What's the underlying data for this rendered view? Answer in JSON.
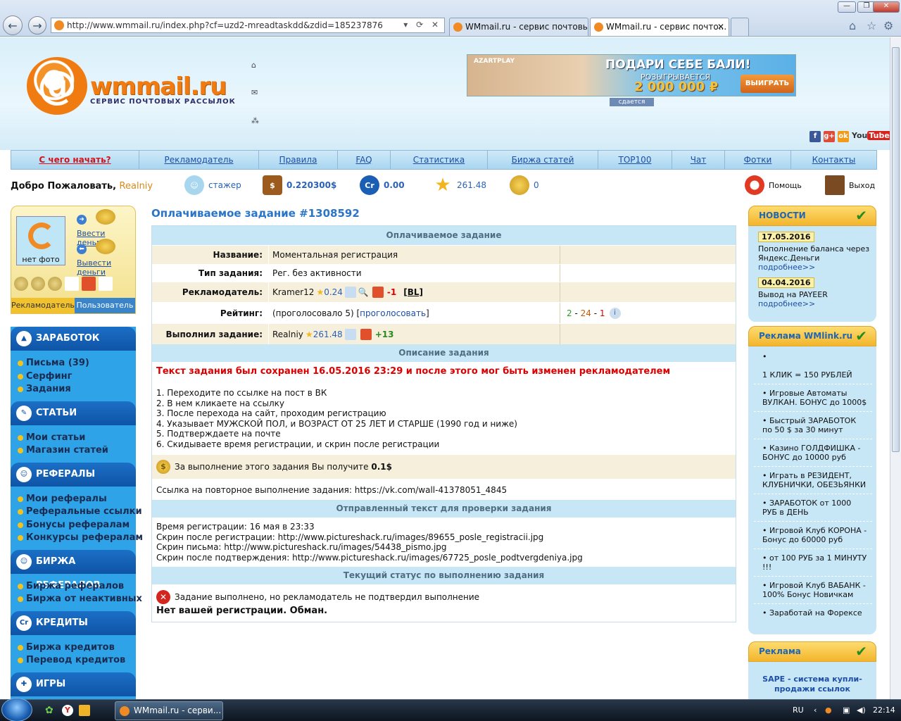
{
  "browser": {
    "url": "http://www.wmmail.ru/index.php?cf=uzd2-mreadtaskdd&zdid=185237876",
    "tabs": [
      "WMmail.ru - сервис почтовы...",
      "WMmail.ru - сервис почто..."
    ]
  },
  "header": {
    "logo_name": "wmmail.ru",
    "logo_sub": "СЕРВИС ПОЧТОВЫХ РАССЫЛОК",
    "banner": {
      "brand": "AZARTPLAY",
      "headline": "ПОДАРИ СЕБЕ БАЛИ!",
      "line2": "РОЗЫГРЫВАЕТСЯ",
      "amount": "2 000 000 ₽",
      "button": "ВЫИГРАТЬ"
    },
    "banner_tag": "сдается",
    "social": [
      "f",
      "g+",
      "ok",
      "YouTube"
    ]
  },
  "menu": [
    "С чего начать?",
    "Рекламодатель",
    "Правила",
    "FAQ",
    "Статистика",
    "Биржа статей",
    "TOP100",
    "Чат",
    "Фотки",
    "Контакты"
  ],
  "welcome": {
    "label": "Добро Пожаловать,",
    "user": "Realniy",
    "rank": "стажер",
    "balance": "0.220300$",
    "credits": "0.00",
    "rating": "261.48",
    "coins": "0",
    "help": "Помощь",
    "exit": "Выход"
  },
  "profile": {
    "photo_caption": "нет фото",
    "deposit": "Ввести деньги",
    "withdraw": "Вывести деньги",
    "tab_advertiser": "Рекламодатель",
    "tab_user": "Пользователь"
  },
  "leftnav": [
    {
      "title": "ЗАРАБОТОК",
      "items": [
        "Письма (39)",
        "Серфинг",
        "Задания"
      ]
    },
    {
      "title": "СТАТЬИ",
      "items": [
        "Мои статьи",
        "Магазин статей"
      ]
    },
    {
      "title": "РЕФЕРАЛЫ",
      "items": [
        "Мои рефералы",
        "Реферальные ссылки",
        "Бонусы рефералам",
        "Конкурсы рефералам"
      ]
    },
    {
      "title": "БИРЖА РЕФЕРАЛОВ",
      "items": [
        "Биржа рефералов",
        "Биржа от неактивных"
      ]
    },
    {
      "title": "КРЕДИТЫ",
      "items": [
        "Биржа кредитов",
        "Перевод кредитов"
      ]
    },
    {
      "title": "ИГРЫ",
      "items": []
    }
  ],
  "task": {
    "page_title": "Оплачиваемое задание #1308592",
    "section_title": "Оплачиваемое задание",
    "name_label": "Название:",
    "name_value": "Моментальная регистрация",
    "type_label": "Тип задания:",
    "type_value": "Рег. без активности",
    "adv_label": "Рекламодатель:",
    "adv_name": "Kramer12",
    "adv_rating": "0.24",
    "adv_score": "-1",
    "adv_bl": "[BL]",
    "rating_label": "Рейтинг:",
    "rating_votes": "(проголосовало 5) [",
    "rating_vote_link": "проголосовать",
    "rating_close": "]",
    "rating_scores": [
      "2",
      "24",
      "1"
    ],
    "done_label": "Выполнил задание:",
    "done_user": "Realniy",
    "done_rating": "261.48",
    "done_score": "+13",
    "desc_title": "Описание задания",
    "saved_notice": "Текст задания был сохранен 16.05.2016 23:29 и после этого мог быть изменен рекламодателем",
    "steps": [
      "1. Переходите по ссылке на пост в ВК",
      "2. В нем кликаете на ссылку",
      "3. После перехода на сайт, проходим регистрацию",
      "4. Указывает МУЖСКОЙ ПОЛ, и ВОЗРАСТ ОТ 25 ЛЕТ И СТАРШЕ (1990 год и ниже)",
      "5. Подтверждаете на почте",
      "6. Скидываете время регистрации, и скрин после регистрации"
    ],
    "reward_text": "За выполнение этого задания Вы получите",
    "reward_value": "0.1$",
    "repeat_label": "Ссылка на повторное выполнение задания:",
    "repeat_link": "https://vk.com/wall-41378051_4845",
    "sent_title": "Отправленный текст для проверки задания",
    "sent_lines": [
      "Время регистрации: 16 мая в 23:33",
      "Скрин после регистрации: http://www.pictureshack.ru/images/89655_posle_registracii.jpg",
      "Скрин письма: http://www.pictureshack.ru/images/54438_pismo.jpg",
      "Скрин после подтверждения: http://www.pictureshack.ru/images/67725_posle_podtvergdeniya.jpg"
    ],
    "status_title": "Текущий статус по выполнению задания",
    "status_text": "Задание выполнено, но рекламодатель не подтвердил выполнение",
    "status_note": "Нет вашей регистрации. Обман."
  },
  "news": {
    "title": "НОВОСТИ",
    "items": [
      {
        "date": "17.05.2016",
        "text": "Пополнение баланса через Яндекс.Деньги",
        "more": "подробнее>>"
      },
      {
        "date": "04.04.2016",
        "text": "Вывод на PAYEER",
        "more": "подробнее>>"
      }
    ]
  },
  "wmlink": {
    "title": "Реклама WMlink.ru",
    "ads": [
      "1 КЛИК = 150 РУБЛЕЙ",
      "Игровые Автоматы ВУЛКАН. БОНУС до 1000$",
      "Быстрый ЗАРАБОТОК по 50 $ за 30 минут",
      "Казино ГОЛДФИШКА - БОНУС до 10000 руб",
      "Играть в РЕЗИДЕНТ, КЛУБНИЧКИ, ОБЕЗЬЯНКИ",
      "ЗАРАБОТОК от 1000 РУБ в ДЕНЬ",
      "Игровой Клуб КОРОНА - Бонус до 60000 руб",
      "от 100 РУБ за 1 МИНУТУ !!!",
      "Игровой Клуб ВАБАНК - 100% Бонус Новичкам",
      "Заработай на Форексе"
    ]
  },
  "reklama": {
    "title": "Реклама",
    "link": "SAPE - система купли-продажи ссылок"
  },
  "taskbar": {
    "task": "WMmail.ru - серви...",
    "lang": "RU",
    "time": "22:14"
  },
  "colors": {
    "accent": "#2b75c9",
    "menu_red": "#d1131b",
    "nav_bg": "#2fa3e7",
    "nav_section": "#0f54a6",
    "table_head": "#c8e7f6",
    "row_beige": "#f6efdc"
  }
}
